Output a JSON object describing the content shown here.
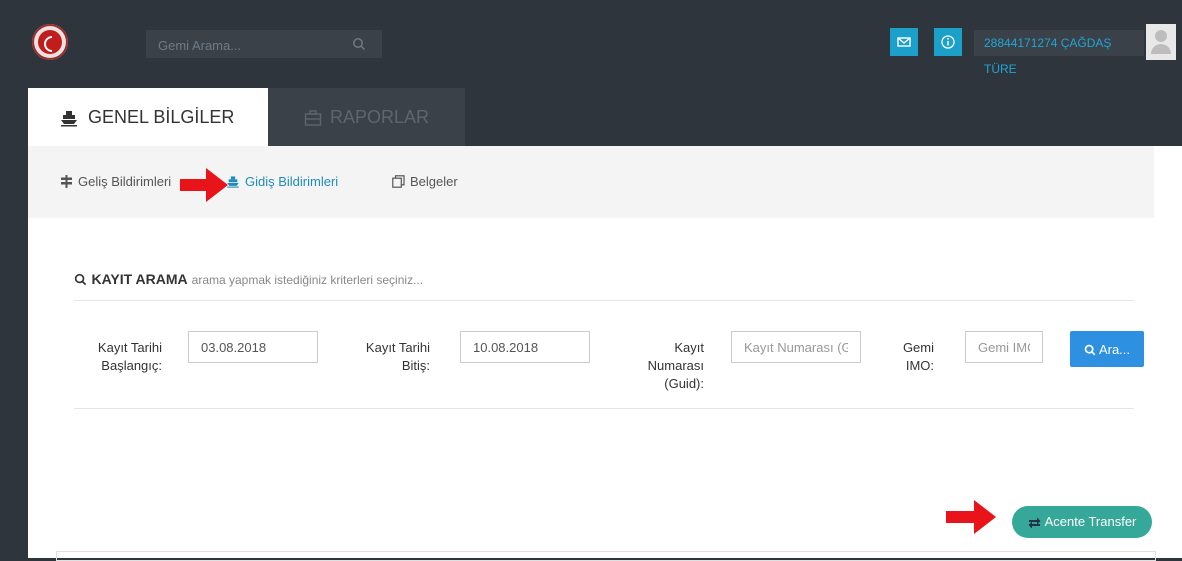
{
  "topbar": {
    "search_placeholder": "Gemi Arama...",
    "user_name": "28844171274 ÇAĞDAŞ TÜRE",
    "icons": [
      "mail-icon",
      "info-icon",
      "user-icon"
    ]
  },
  "tabs": [
    {
      "label": "GENEL BİLGİLER",
      "icon": "ship-icon",
      "active": true
    },
    {
      "label": "RAPORLAR",
      "icon": "briefcase-icon",
      "active": false
    }
  ],
  "subnav": [
    {
      "label": "Geliş Bildirimleri",
      "icon": "signpost-icon",
      "active": false
    },
    {
      "label": "Gidiş Bildirimleri",
      "icon": "ship-icon",
      "active": true
    },
    {
      "label": "Belgeler",
      "icon": "copy-icon",
      "active": false
    }
  ],
  "search_panel": {
    "title": "KAYIT ARAMA",
    "subtitle": "arama yapmak istediğiniz kriterleri seçiniz...",
    "fields": [
      {
        "label_lines": [
          "Kayıt Tarihi",
          "Başlangıç:"
        ],
        "value": "03.08.2018",
        "placeholder": ""
      },
      {
        "label_lines": [
          "Kayıt Tarihi",
          "Bitiş:"
        ],
        "value": "10.08.2018",
        "placeholder": ""
      },
      {
        "label_lines": [
          "Kayıt",
          "Numarası",
          "(Guid):"
        ],
        "value": "",
        "placeholder": "Kayıt Numarası (Guid)"
      },
      {
        "label_lines": [
          "Gemi",
          "IMO:"
        ],
        "value": "",
        "placeholder": "Gemi IMO"
      }
    ],
    "search_button": "Ara..."
  },
  "transfer_button": "Acente Transfer",
  "colors": {
    "topbar_bg": "#2e353d",
    "accent_blue": "#1aa0c9",
    "search_button": "#2e90e0",
    "transfer_button": "#35a89a",
    "annotation_arrow": "#e8141a"
  }
}
